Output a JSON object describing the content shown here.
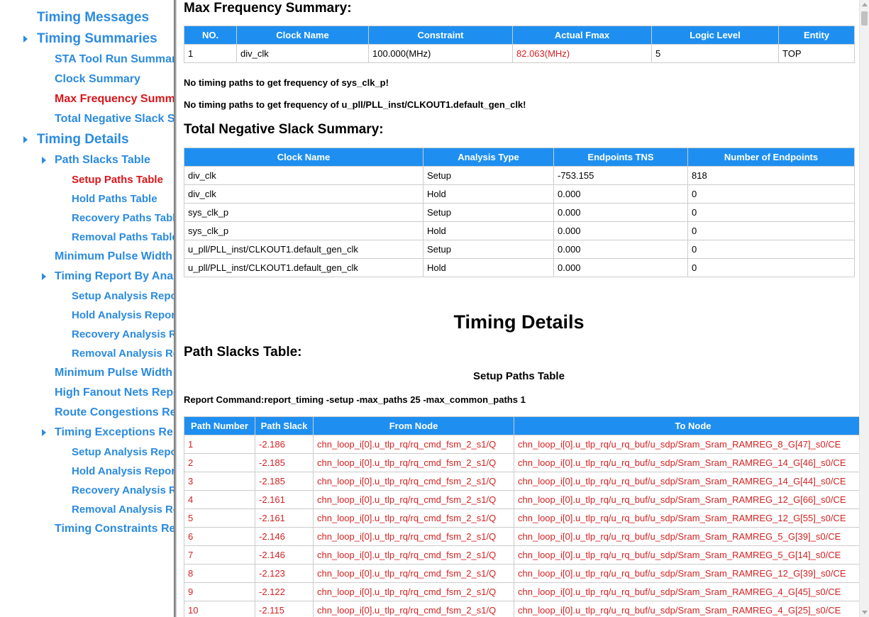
{
  "sidebar": {
    "items": [
      {
        "label": "Timing Messages",
        "active": false
      },
      {
        "label": "Timing Summaries",
        "active": false
      },
      {
        "label": "STA Tool Run Summary",
        "active": false
      },
      {
        "label": "Clock Summary",
        "active": false
      },
      {
        "label": "Max Frequency Summary",
        "active": true
      },
      {
        "label": "Total Negative Slack Summary",
        "active": false
      },
      {
        "label": "Timing Details",
        "active": false
      },
      {
        "label": "Path Slacks Table",
        "active": false
      },
      {
        "label": "Setup Paths Table",
        "active": true
      },
      {
        "label": "Hold Paths Table",
        "active": false
      },
      {
        "label": "Recovery Paths Table",
        "active": false
      },
      {
        "label": "Removal Paths Table",
        "active": false
      },
      {
        "label": "Minimum Pulse Width Table",
        "active": false
      },
      {
        "label": "Timing Report By Analysis Type",
        "active": false
      },
      {
        "label": "Setup Analysis Report",
        "active": false
      },
      {
        "label": "Hold Analysis Report",
        "active": false
      },
      {
        "label": "Recovery Analysis Report",
        "active": false
      },
      {
        "label": "Removal Analysis Report",
        "active": false
      },
      {
        "label": "Minimum Pulse Width Report",
        "active": false
      },
      {
        "label": "High Fanout Nets Report",
        "active": false
      },
      {
        "label": "Route Congestions Report",
        "active": false
      },
      {
        "label": "Timing Exceptions Report",
        "active": false
      },
      {
        "label": "Setup Analysis Report",
        "active": false
      },
      {
        "label": "Hold Analysis Report",
        "active": false
      },
      {
        "label": "Recovery Analysis Report",
        "active": false
      },
      {
        "label": "Removal Analysis Report",
        "active": false
      },
      {
        "label": "Timing Constraints Report",
        "active": false
      }
    ]
  },
  "main": {
    "max_freq": {
      "title": "Max Frequency Summary:",
      "headers": [
        "NO.",
        "Clock Name",
        "Constraint",
        "Actual Fmax",
        "Logic Level",
        "Entity"
      ],
      "rows": [
        [
          "1",
          "div_clk",
          "100.000(MHz)",
          "82.063(MHz)",
          "5",
          "TOP"
        ]
      ],
      "notes": [
        "No timing paths to get frequency of sys_clk_p!",
        "No timing paths to get frequency of u_pll/PLL_inst/CLKOUT1.default_gen_clk!"
      ]
    },
    "tns": {
      "title": "Total Negative Slack Summary:",
      "headers": [
        "Clock Name",
        "Analysis Type",
        "Endpoints TNS",
        "Number of Endpoints"
      ],
      "rows": [
        [
          "div_clk",
          "Setup",
          "-753.155",
          "818"
        ],
        [
          "div_clk",
          "Hold",
          "0.000",
          "0"
        ],
        [
          "sys_clk_p",
          "Setup",
          "0.000",
          "0"
        ],
        [
          "sys_clk_p",
          "Hold",
          "0.000",
          "0"
        ],
        [
          "u_pll/PLL_inst/CLKOUT1.default_gen_clk",
          "Setup",
          "0.000",
          "0"
        ],
        [
          "u_pll/PLL_inst/CLKOUT1.default_gen_clk",
          "Hold",
          "0.000",
          "0"
        ]
      ]
    },
    "details_title": "Timing Details",
    "path_slacks_title": "Path Slacks Table:",
    "setup_table_title": "Setup Paths Table",
    "report_command": "Report Command:report_timing -setup -max_paths 25 -max_common_paths 1",
    "paths": {
      "headers": [
        "Path Number",
        "Path Slack",
        "From Node",
        "To Node"
      ],
      "rows": [
        [
          "1",
          "-2.186",
          "chn_loop_i[0].u_tlp_rq/rq_cmd_fsm_2_s1/Q",
          "chn_loop_i[0].u_tlp_rq/u_rq_buf/u_sdp/Sram_Sram_RAMREG_8_G[47]_s0/CE"
        ],
        [
          "2",
          "-2.185",
          "chn_loop_i[0].u_tlp_rq/rq_cmd_fsm_2_s1/Q",
          "chn_loop_i[0].u_tlp_rq/u_rq_buf/u_sdp/Sram_Sram_RAMREG_14_G[46]_s0/CE"
        ],
        [
          "3",
          "-2.185",
          "chn_loop_i[0].u_tlp_rq/rq_cmd_fsm_2_s1/Q",
          "chn_loop_i[0].u_tlp_rq/u_rq_buf/u_sdp/Sram_Sram_RAMREG_14_G[44]_s0/CE"
        ],
        [
          "4",
          "-2.161",
          "chn_loop_i[0].u_tlp_rq/rq_cmd_fsm_2_s1/Q",
          "chn_loop_i[0].u_tlp_rq/u_rq_buf/u_sdp/Sram_Sram_RAMREG_12_G[66]_s0/CE"
        ],
        [
          "5",
          "-2.161",
          "chn_loop_i[0].u_tlp_rq/rq_cmd_fsm_2_s1/Q",
          "chn_loop_i[0].u_tlp_rq/u_rq_buf/u_sdp/Sram_Sram_RAMREG_12_G[55]_s0/CE"
        ],
        [
          "6",
          "-2.146",
          "chn_loop_i[0].u_tlp_rq/rq_cmd_fsm_2_s1/Q",
          "chn_loop_i[0].u_tlp_rq/u_rq_buf/u_sdp/Sram_Sram_RAMREG_5_G[39]_s0/CE"
        ],
        [
          "7",
          "-2.146",
          "chn_loop_i[0].u_tlp_rq/rq_cmd_fsm_2_s1/Q",
          "chn_loop_i[0].u_tlp_rq/u_rq_buf/u_sdp/Sram_Sram_RAMREG_5_G[14]_s0/CE"
        ],
        [
          "8",
          "-2.123",
          "chn_loop_i[0].u_tlp_rq/rq_cmd_fsm_2_s1/Q",
          "chn_loop_i[0].u_tlp_rq/u_rq_buf/u_sdp/Sram_Sram_RAMREG_12_G[39]_s0/CE"
        ],
        [
          "9",
          "-2.122",
          "chn_loop_i[0].u_tlp_rq/rq_cmd_fsm_2_s1/Q",
          "chn_loop_i[0].u_tlp_rq/u_rq_buf/u_sdp/Sram_Sram_RAMREG_4_G[45]_s0/CE"
        ],
        [
          "10",
          "-2.115",
          "chn_loop_i[0].u_tlp_rq/rq_cmd_fsm_2_s1/Q",
          "chn_loop_i[0].u_tlp_rq/u_rq_buf/u_sdp/Sram_Sram_RAMREG_4_G[25]_s0/CE"
        ]
      ]
    }
  },
  "colors": {
    "link": "#2b8be0",
    "active": "#d8161a",
    "header_bg": "#1e8ff0",
    "violation": "#d32222"
  }
}
